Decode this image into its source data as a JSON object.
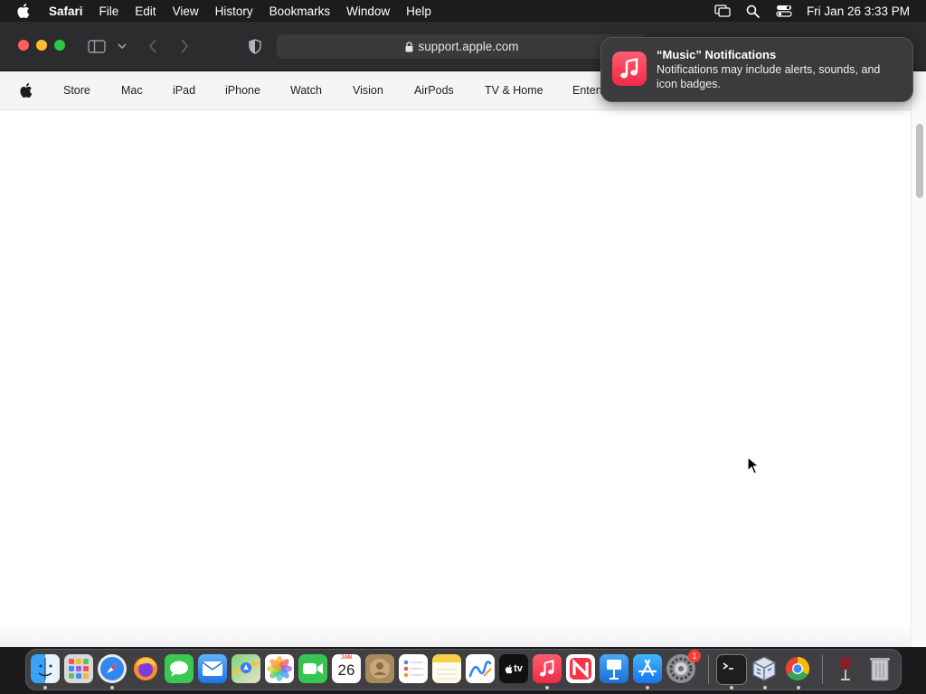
{
  "menubar": {
    "app_name": "Safari",
    "items": [
      "File",
      "Edit",
      "View",
      "History",
      "Bookmarks",
      "Window",
      "Help"
    ],
    "clock": "Fri Jan 26  3:33 PM",
    "icons": [
      "apple-logo",
      "screen-mirroring-icon",
      "spotlight-search-icon",
      "control-center-icon"
    ]
  },
  "browser": {
    "url": "support.apple.com",
    "icons": [
      "sidebar-toggle-icon",
      "chevron-down-icon",
      "back-icon",
      "forward-icon",
      "privacy-shield-icon",
      "lock-icon"
    ]
  },
  "site_nav": {
    "items": [
      "Store",
      "Mac",
      "iPad",
      "iPhone",
      "Watch",
      "Vision",
      "AirPods",
      "TV & Home",
      "Entert"
    ]
  },
  "notification": {
    "title": "“Music” Notifications",
    "body": "Notifications may include alerts, sounds, and icon badges."
  },
  "calendar_icon": {
    "month": "JAN",
    "day": "26"
  },
  "dock": {
    "apps": [
      "Finder",
      "Launchpad",
      "Safari",
      "Firefox",
      "Messages",
      "Mail",
      "Maps",
      "Photos",
      "FaceTime",
      "Calendar",
      "Contacts",
      "Reminders",
      "Notes",
      "Freeform",
      "TV",
      "Music",
      "News",
      "Keynote",
      "App Store",
      "System Settings",
      "Terminal",
      "VirtualBox",
      "Chrome",
      "Wine",
      "Trash"
    ],
    "settings_badge": "1",
    "tv_label": "tv"
  },
  "colors": {
    "accent_red": "#ff3b30",
    "music_pink": "#f12a46",
    "menubar_bg": "#1c1c1e",
    "nav_bg": "#f5f5f7"
  }
}
